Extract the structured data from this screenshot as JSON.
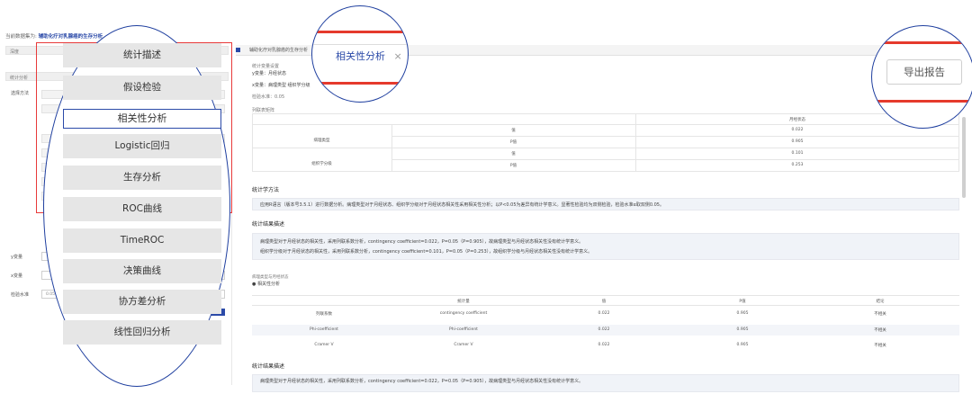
{
  "header": {
    "prefix": "当前数据集为:",
    "dataset": "辅助化疗对乳腺癌的生存分析"
  },
  "left": {
    "row1": "深度",
    "row2": "统计分析",
    "select_method_label": "选择方法",
    "y_label": "y变量",
    "x_label": "x变量",
    "level_label": "检验水准",
    "level_value": "0.05",
    "run_button": "运行该方案"
  },
  "menu": {
    "items": [
      "统计描述",
      "假设检验",
      "相关性分析",
      "Logistic回归",
      "生存分析",
      "ROC曲线",
      "TimeROC",
      "决策曲线",
      "协方差分析",
      "线性回归分析"
    ],
    "active": "相关性分析"
  },
  "tabs": {
    "first": "辅助化疗对乳腺癌的生存分析",
    "active_label": "相关性分析",
    "close_glyph": "×"
  },
  "toolbar": {
    "export_label": "导出报告"
  },
  "content": {
    "settings_title": "统计变量设置",
    "y_var": "y变量：月经状态",
    "x_var": "x变量：病理类型 组织学分级",
    "alpha": "检验水准：0.05",
    "table1": {
      "caption": "列联表矩阵",
      "col_header": "月经状态",
      "rows": [
        {
          "group": "病理类型",
          "stats": [
            {
              "name": "值",
              "value": "0.022"
            },
            {
              "name": "P值",
              "value": "0.905"
            }
          ]
        },
        {
          "group": "组织学分级",
          "stats": [
            {
              "name": "值",
              "value": "0.101"
            },
            {
              "name": "P值",
              "value": "0.253"
            }
          ]
        }
      ]
    },
    "method_title": "统计学方法",
    "method_text": "应用R语言（版本号3.5.1）进行数据分析。病理类型对于月经状态、组织学分级对于月经状态相关性采用相关性分析；以P<0.05为差异有统计学意义。显著性检验均为双侧检验，检验水准α取双侧0.05。",
    "result_title": "统计结果描述",
    "result_lines": [
      "病理类型对于月经状态的相关性，采用列联系数分析，contingency coefficient=0.022，P=0.05（P=0.905），故病理类型与月经状态相关性没有统计学意义。",
      "组织学分级对于月经状态的相关性，采用列联系数分析，contingency coefficient=0.101，P=0.05（P=0.253），故组织学分级与月经状态相关性没有统计学意义。"
    ],
    "sub_caption": "病理类型与月经状态",
    "bullet_title": "● 相关性分析",
    "table2": {
      "headers": [
        "统计量",
        "值",
        "P值",
        "结论"
      ],
      "rows": [
        [
          "列联系数",
          "contingency coefficient",
          "0.022",
          "0.905",
          "不相关"
        ],
        [
          "Phi-coefficient",
          "Phi-coefficient",
          "0.022",
          "0.905",
          "不相关"
        ],
        [
          "Cramer V",
          "Cramer V",
          "0.022",
          "0.905",
          "不相关"
        ]
      ]
    },
    "result2_title": "统计结果描述",
    "result2_line": "病理类型对于月经状态的相关性，采用列联系数分析，contingency coefficient=0.022，P=0.05（P=0.905），故病理类型与月经状态相关性没有统计学意义。"
  }
}
